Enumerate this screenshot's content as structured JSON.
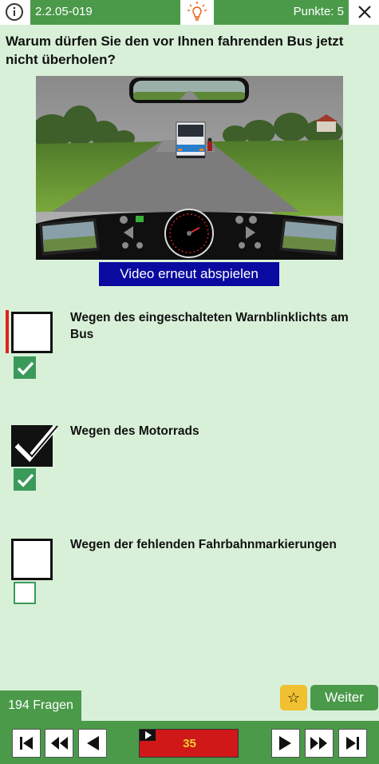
{
  "header": {
    "question_id": "2.2.05-019",
    "points_label": "Punkte: 5"
  },
  "question": {
    "text": "Warum dürfen Sie den vor Ihnen fahrenden Bus jetzt nicht überholen?"
  },
  "video": {
    "replay_label": "Video erneut abspielen"
  },
  "answers": [
    {
      "text": "Wegen des eingeschalteten Warnblinklichts am Bus",
      "user_checked": false,
      "correct": true,
      "marked_wrong": true
    },
    {
      "text": "Wegen des Motorrads",
      "user_checked": true,
      "correct": true,
      "marked_wrong": false
    },
    {
      "text": "Wegen der fehlenden Fahrbahnmarkierungen",
      "user_checked": false,
      "correct": false,
      "marked_wrong": false
    }
  ],
  "footer": {
    "questions_count_label": "194 Fragen",
    "next_label": "Weiter",
    "star_icon": "star-icon",
    "progress_value": "35"
  },
  "colors": {
    "primary_green": "#4a9a4a",
    "background": "#d8f0d8",
    "video_button": "#0a0aa0",
    "progress_bar": "#d01818",
    "star": "#f0c030",
    "error_marker": "#e02020"
  }
}
